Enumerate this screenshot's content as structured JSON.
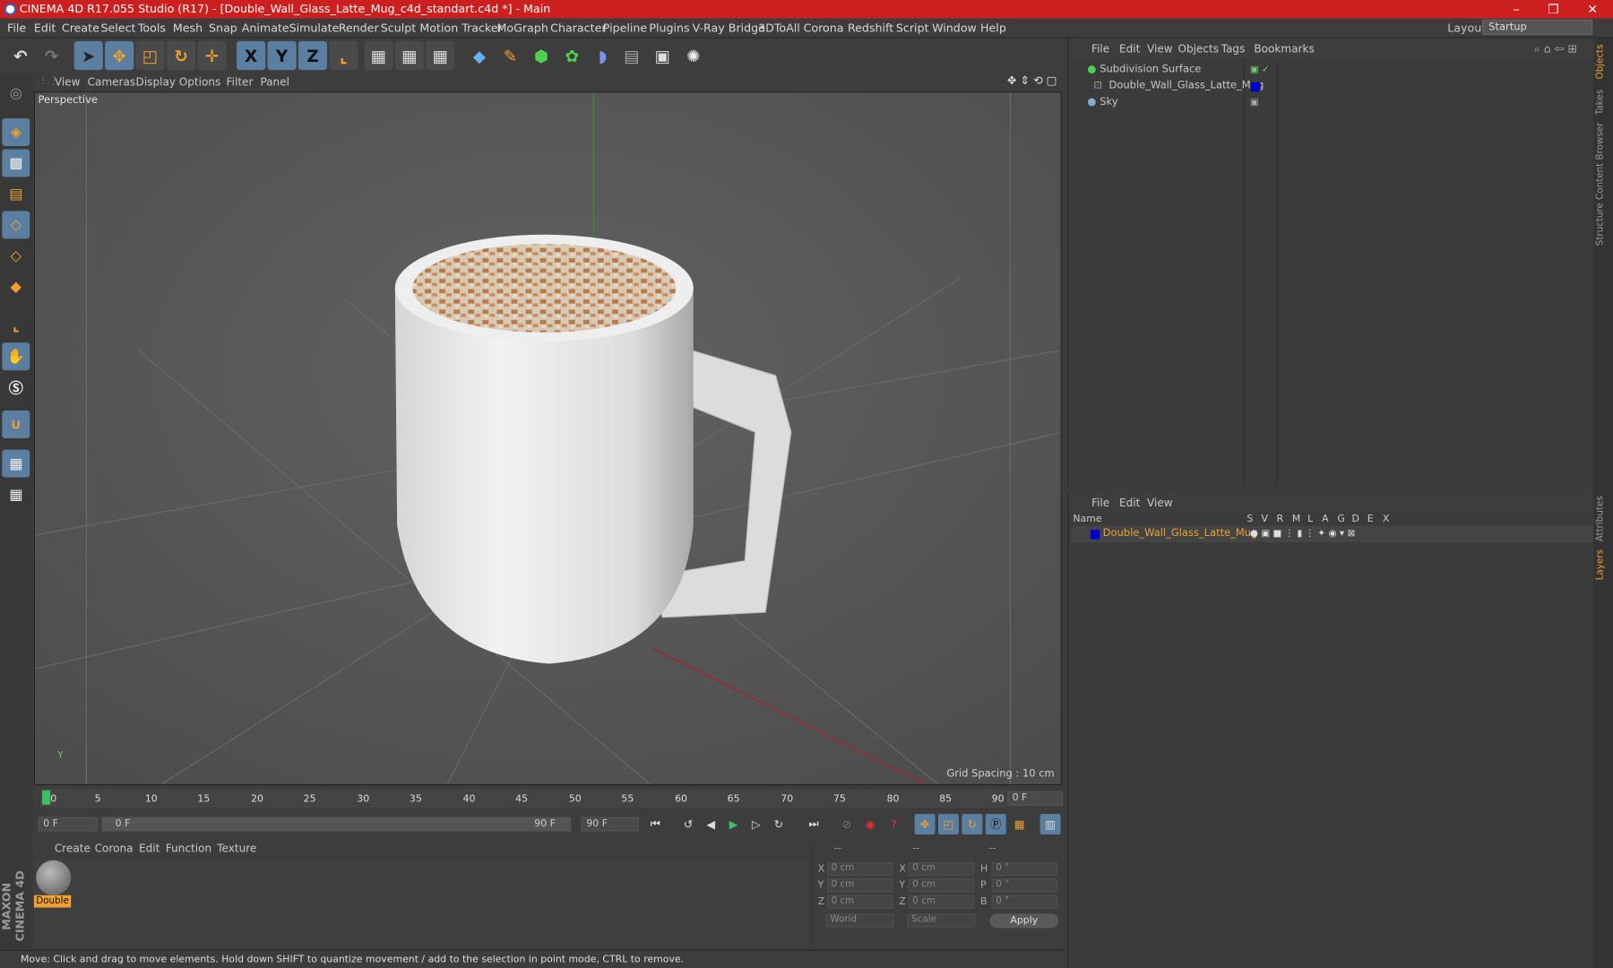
{
  "window": {
    "title": "CINEMA 4D R17.055 Studio (R17) - [Double_Wall_Glass_Latte_Mug_c4d_standart.c4d *] - Main",
    "controls": [
      "–",
      "❐",
      "✕"
    ]
  },
  "menubar": {
    "items": [
      "File",
      "Edit",
      "Create",
      "Select",
      "Tools",
      "Mesh",
      "Snap",
      "Animate",
      "Simulate",
      "Render",
      "Sculpt",
      "Motion Tracker",
      "MoGraph",
      "Character",
      "Pipeline",
      "Plugins",
      "V-Ray Bridge",
      "3DToAll",
      "Corona",
      "Redshift",
      "Script",
      "Window",
      "Help"
    ],
    "layout_label": "Layout:",
    "layout_value": "Startup"
  },
  "toolbar": {
    "x": "X",
    "y": "Y",
    "z": "Z"
  },
  "viewport": {
    "menu": [
      "View",
      "Cameras",
      "Display",
      "Options",
      "Filter",
      "Panel"
    ],
    "label": "Perspective",
    "grid_spacing": "Grid Spacing : 10 cm"
  },
  "timeline": {
    "ticks": [
      "0",
      "5",
      "10",
      "15",
      "20",
      "25",
      "30",
      "35",
      "40",
      "45",
      "50",
      "55",
      "60",
      "65",
      "70",
      "75",
      "80",
      "85",
      "90"
    ],
    "end_field": "0 F"
  },
  "transport": {
    "start": "0 F",
    "range_start": "0 F",
    "range_end": "90 F",
    "end": "90 F"
  },
  "material_panel": {
    "menu": [
      "Create",
      "Corona",
      "Edit",
      "Function",
      "Texture"
    ],
    "material_name": "Double"
  },
  "coords": {
    "headers": [
      "--",
      "--",
      "--"
    ],
    "rows": [
      {
        "a": "X",
        "av": "0 cm",
        "b": "X",
        "bv": "0 cm",
        "c": "H",
        "cv": "0 °"
      },
      {
        "a": "Y",
        "av": "0 cm",
        "b": "Y",
        "bv": "0 cm",
        "c": "P",
        "cv": "0 °"
      },
      {
        "a": "Z",
        "av": "0 cm",
        "b": "Z",
        "bv": "0 cm",
        "c": "B",
        "cv": "0 °"
      }
    ],
    "world": "World",
    "scale": "Scale",
    "apply": "Apply"
  },
  "status": "Move: Click and drag to move elements. Hold down SHIFT to quantize movement / add to the selection in point mode, CTRL to remove.",
  "object_manager": {
    "menu": [
      "File",
      "Edit",
      "View",
      "Objects",
      "Tags",
      "Bookmarks"
    ],
    "objects": [
      "Subdivision Surface",
      "Double_Wall_Glass_Latte_Mug",
      "Sky"
    ]
  },
  "layer_manager": {
    "menu": [
      "File",
      "Edit",
      "View"
    ],
    "columns": [
      "Name",
      "S",
      "V",
      "R",
      "M",
      "L",
      "A",
      "G",
      "D",
      "E",
      "X"
    ],
    "layer": "Double_Wall_Glass_Latte_Mug"
  },
  "side_tabs": [
    "Objects",
    "Takes",
    "Content Browser",
    "Structure",
    "Attributes",
    "Layers"
  ],
  "brand": "MAXON CINEMA 4D",
  "colors": {
    "title": "#cc1f1f",
    "accent": "#f0a030",
    "layer_blue": "#0000cc"
  }
}
